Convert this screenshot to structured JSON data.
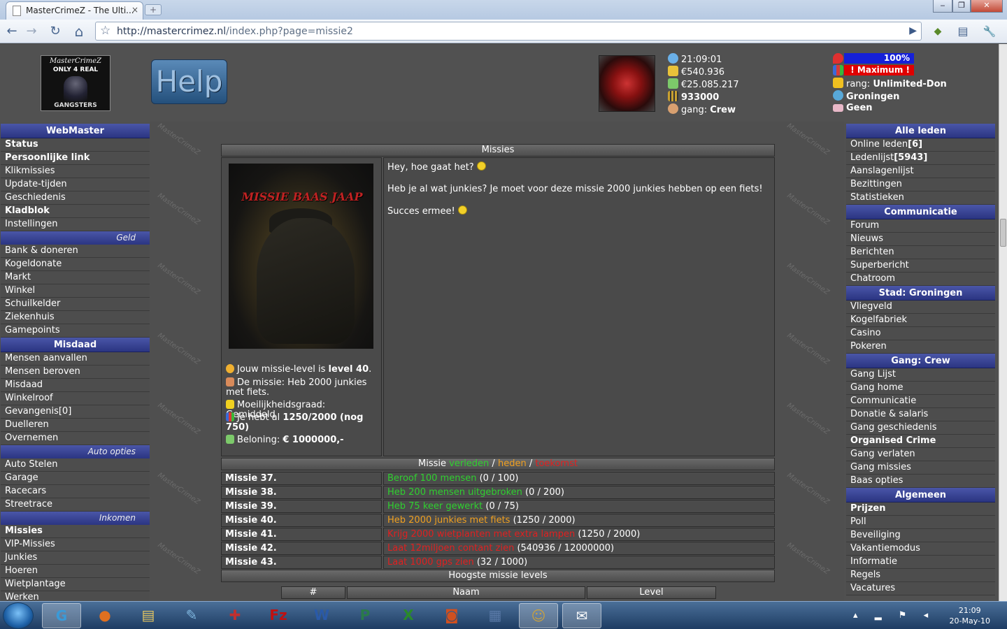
{
  "browser": {
    "tab_title": "MasterCrimeZ - The Ulti...",
    "tab_close": "×",
    "new_tab": "+",
    "url_host": "http://mastercrimez.nl",
    "url_path": "/index.php?page=missie2",
    "win_min": "‒",
    "win_max": "❐",
    "win_close": "✕",
    "nav_back": "←",
    "nav_forward": "→",
    "nav_reload": "↻",
    "nav_home": "⌂",
    "star": "☆",
    "go": "▶",
    "page_menu": "▤",
    "tools_menu": "🔧"
  },
  "header": {
    "logo_line1": "MasterCrimeZ",
    "logo_line2": "ONLY 4 REAL",
    "logo_line3": "GANGSTERS",
    "help": "Help",
    "time": "21:09:01",
    "cash": "€540.936",
    "bank": "€25.085.217",
    "bullets": "933000",
    "gang_label": "gang: ",
    "gang": "Crew",
    "health": "100%",
    "power": "! Maximum !",
    "rank_label": "rang: ",
    "rank": "Unlimited-Don",
    "city": "Groningen",
    "messages": "Geen"
  },
  "left_menu": [
    {
      "type": "hd",
      "label": "WebMaster"
    },
    {
      "type": "it",
      "label": "Status",
      "bold": true
    },
    {
      "type": "it",
      "label": "Persoonlijke link",
      "bold": true
    },
    {
      "type": "it",
      "label": "Klikmissies"
    },
    {
      "type": "it",
      "label": "Update-tijden"
    },
    {
      "type": "it",
      "label": "Geschiedenis"
    },
    {
      "type": "it",
      "label": "Kladblok",
      "bold": true
    },
    {
      "type": "it",
      "label": "Instellingen"
    },
    {
      "type": "sub",
      "label": "Geld"
    },
    {
      "type": "it",
      "label": "Bank & doneren"
    },
    {
      "type": "it",
      "label": "Kogeldonate"
    },
    {
      "type": "it",
      "label": "Markt"
    },
    {
      "type": "it",
      "label": "Winkel"
    },
    {
      "type": "it",
      "label": "Schuilkelder"
    },
    {
      "type": "it",
      "label": "Ziekenhuis"
    },
    {
      "type": "it",
      "label": "Gamepoints"
    },
    {
      "type": "hd",
      "label": "Misdaad"
    },
    {
      "type": "it",
      "label": "Mensen aanvallen"
    },
    {
      "type": "it",
      "label": "Mensen beroven"
    },
    {
      "type": "it",
      "label": "Misdaad"
    },
    {
      "type": "it",
      "label": "Winkelroof"
    },
    {
      "type": "it",
      "label": "Gevangenis[0]"
    },
    {
      "type": "it",
      "label": "Duelleren"
    },
    {
      "type": "it",
      "label": "Overnemen"
    },
    {
      "type": "sub",
      "label": "Auto opties"
    },
    {
      "type": "it",
      "label": "Auto Stelen"
    },
    {
      "type": "it",
      "label": "Garage"
    },
    {
      "type": "it",
      "label": "Racecars"
    },
    {
      "type": "it",
      "label": "Streetrace"
    },
    {
      "type": "sub",
      "label": "Inkomen"
    },
    {
      "type": "it",
      "label": "Missies",
      "bold": true
    },
    {
      "type": "it",
      "label": "VIP-Missies"
    },
    {
      "type": "it",
      "label": "Junkies"
    },
    {
      "type": "it",
      "label": "Hoeren"
    },
    {
      "type": "it",
      "label": "Wietplantage"
    },
    {
      "type": "it",
      "label": "Werken"
    }
  ],
  "right_menu": [
    {
      "type": "hd",
      "label": "Alle leden"
    },
    {
      "type": "it",
      "label": "Online leden",
      "extra": "[6]"
    },
    {
      "type": "it",
      "label": "Ledenlijst",
      "extra": "[5943]"
    },
    {
      "type": "it",
      "label": "Aanslagenlijst"
    },
    {
      "type": "it",
      "label": "Bezittingen"
    },
    {
      "type": "it",
      "label": "Statistieken"
    },
    {
      "type": "hd",
      "label": "Communicatie"
    },
    {
      "type": "it",
      "label": "Forum"
    },
    {
      "type": "it",
      "label": "Nieuws"
    },
    {
      "type": "it",
      "label": "Berichten"
    },
    {
      "type": "it",
      "label": "Superbericht"
    },
    {
      "type": "it",
      "label": "Chatroom"
    },
    {
      "type": "hd",
      "label": "Stad: Groningen"
    },
    {
      "type": "it",
      "label": "Vliegveld"
    },
    {
      "type": "it",
      "label": "Kogelfabriek"
    },
    {
      "type": "it",
      "label": "Casino"
    },
    {
      "type": "it",
      "label": "Pokeren"
    },
    {
      "type": "hd",
      "label": "Gang: Crew"
    },
    {
      "type": "it",
      "label": "Gang Lijst"
    },
    {
      "type": "it",
      "label": "Gang home"
    },
    {
      "type": "it",
      "label": "Communicatie"
    },
    {
      "type": "it",
      "label": "Donatie & salaris"
    },
    {
      "type": "it",
      "label": "Gang geschiedenis"
    },
    {
      "type": "it",
      "label": "Organised Crime",
      "bold": true
    },
    {
      "type": "it",
      "label": "Gang verlaten"
    },
    {
      "type": "it",
      "label": "Gang missies"
    },
    {
      "type": "it",
      "label": "Baas opties"
    },
    {
      "type": "hd",
      "label": "Algemeen"
    },
    {
      "type": "it",
      "label": "Prijzen",
      "bold": true
    },
    {
      "type": "it",
      "label": "Poll"
    },
    {
      "type": "it",
      "label": "Beveiliging"
    },
    {
      "type": "it",
      "label": "Vakantiemodus"
    },
    {
      "type": "it",
      "label": "Informatie"
    },
    {
      "type": "it",
      "label": "Regels"
    },
    {
      "type": "it",
      "label": "Vacatures"
    }
  ],
  "missions": {
    "title": "Missies",
    "image_title": "MISSIE BAAS JAAP",
    "level_pre": "Jouw missie-level is ",
    "level": "level 40",
    "level_post": ".",
    "mission_text": "De missie: Heb 2000 junkies met fiets.",
    "difficulty": "Moeilijkheidsgraad: Gemiddeld",
    "progress_pre": "Je hebt al ",
    "progress": "1250/2000 (nog 750)",
    "reward_pre": "Beloning: ",
    "reward": "€ 1000000,-",
    "greeting": "Hey, hoe gaat het?",
    "question": "Heb je al wat junkies? Je moet voor deze missie 2000 junkies hebben op een fiets!",
    "luck": "Succes ermee!",
    "list_title": "Missie ",
    "past": "verleden",
    "present": "heden",
    "future": "toekomst",
    "sep": " / ",
    "list": [
      {
        "name": "Missie 37.",
        "task": "Beroof 100 mensen",
        "progress": " (0 / 100)",
        "status": "green"
      },
      {
        "name": "Missie 38.",
        "task": "Heb 200 mensen uitgebroken",
        "progress": " (0 / 200)",
        "status": "green"
      },
      {
        "name": "Missie 39.",
        "task": "Heb 75 keer gewerkt",
        "progress": " (0 / 75)",
        "status": "green"
      },
      {
        "name": "Missie 40.",
        "task": "Heb 2000 junkies met fiets",
        "progress": " (1250 / 2000)",
        "status": "orange"
      },
      {
        "name": "Missie 41.",
        "task": "Krijg 2000 wietplanten met extra lampen",
        "progress": " (1250 / 2000)",
        "status": "red"
      },
      {
        "name": "Missie 42.",
        "task": "Laat 12miljoen contant zien",
        "progress": " (540936 / 12000000)",
        "status": "red"
      },
      {
        "name": "Missie 43.",
        "task": "Laat 1000 gps zien",
        "progress": " (32 / 1000)",
        "status": "red"
      }
    ],
    "highest_title": "Hoogste missie levels",
    "col_num": "#",
    "col_name": "Naam",
    "col_level": "Level"
  },
  "taskbar": {
    "time": "21:09",
    "date": "20-May-10",
    "apps": [
      "G",
      "●",
      "▤",
      "✎",
      "✚",
      "Fz",
      "W",
      "P",
      "X",
      "◙",
      "▦",
      "☺",
      "✉"
    ]
  }
}
